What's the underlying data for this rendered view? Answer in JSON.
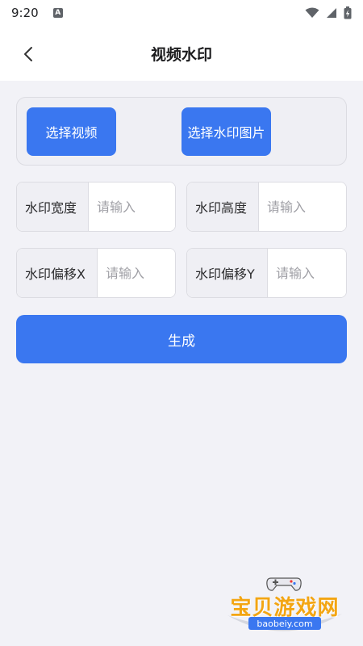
{
  "status_bar": {
    "time": "9:20",
    "a_label": "A"
  },
  "header": {
    "title": "视频水印"
  },
  "select_card": {
    "select_video_label": "选择视频",
    "select_image_label": "选择水印图片"
  },
  "fields": {
    "width": {
      "label": "水印宽度",
      "placeholder": "请输入"
    },
    "height": {
      "label": "水印高度",
      "placeholder": "请输入"
    },
    "x": {
      "label": "水印偏移X",
      "placeholder": "请输入"
    },
    "y": {
      "label": "水印偏移Y",
      "placeholder": "请输入"
    }
  },
  "generate": {
    "label": "生成"
  },
  "watermark": {
    "name": "宝贝游戏网",
    "url": "baobeiy.com"
  },
  "colors": {
    "accent": "#3a77f0",
    "background": "#f2f2f7",
    "logo_orange": "#f3a512"
  },
  "icons": {
    "back": "chevron-left-icon",
    "wifi": "wifi-icon",
    "signal": "signal-icon",
    "battery": "battery-icon",
    "gamepad": "gamepad-icon"
  }
}
